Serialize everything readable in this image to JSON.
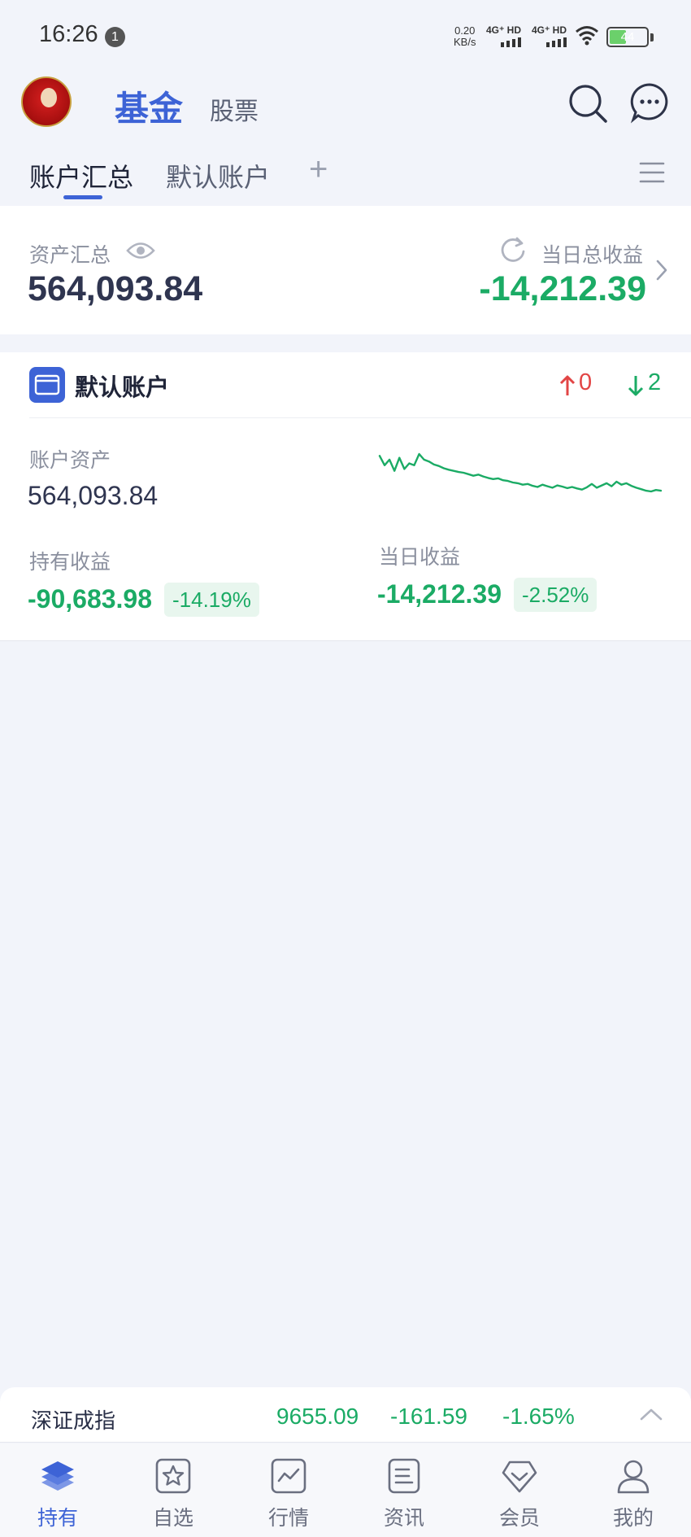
{
  "status_bar": {
    "time": "16:26",
    "notification_count": "1",
    "net_speed_value": "0.20",
    "net_speed_unit": "KB/s",
    "sim1": "4G⁺ HD",
    "sim2": "4G⁺ HD",
    "battery": "44"
  },
  "header": {
    "tab_fund": "基金",
    "tab_stock": "股票"
  },
  "subtabs": {
    "active": "账户汇总",
    "default_account": "默认账户",
    "add": "+"
  },
  "summary": {
    "total_assets_label": "资产汇总",
    "total_assets": "564,093.84",
    "daily_profit_label": "当日总收益",
    "daily_profit": "-14,212.39"
  },
  "account": {
    "name": "默认账户",
    "up_count": "0",
    "down_count": "2",
    "assets_label": "账户资产",
    "assets": "564,093.84",
    "holding_profit_label": "持有收益",
    "holding_profit": "-90,683.98",
    "holding_profit_pct": "-14.19%",
    "daily_profit_label": "当日收益",
    "daily_profit": "-14,212.39",
    "daily_profit_pct": "-2.52%",
    "trend": [
      0.95,
      0.7,
      0.85,
      0.55,
      0.9,
      0.6,
      0.75,
      0.7,
      1.0,
      0.85,
      0.8,
      0.72,
      0.68,
      0.62,
      0.58,
      0.55,
      0.52,
      0.5,
      0.46,
      0.42,
      0.45,
      0.4,
      0.36,
      0.33,
      0.35,
      0.3,
      0.28,
      0.24,
      0.22,
      0.18,
      0.2,
      0.15,
      0.12,
      0.18,
      0.14,
      0.1,
      0.16,
      0.13,
      0.09,
      0.12,
      0.08,
      0.05,
      0.11,
      0.2,
      0.1,
      0.16,
      0.22,
      0.14,
      0.26,
      0.18,
      0.22,
      0.15,
      0.1,
      0.06,
      0.02,
      0.0,
      0.04,
      0.02
    ]
  },
  "index_bar": {
    "name": "深证成指",
    "value": "9655.09",
    "change": "-161.59",
    "change_pct": "-1.65%"
  },
  "bottom_nav": [
    {
      "label": "持有",
      "icon": "holdings-layers-icon",
      "active": true
    },
    {
      "label": "自选",
      "icon": "watchlist-star-icon",
      "active": false
    },
    {
      "label": "行情",
      "icon": "market-chart-icon",
      "active": false
    },
    {
      "label": "资讯",
      "icon": "news-document-icon",
      "active": false
    },
    {
      "label": "会员",
      "icon": "member-diamond-icon",
      "active": false
    },
    {
      "label": "我的",
      "icon": "profile-person-icon",
      "active": false
    }
  ],
  "colors": {
    "accent": "#3d63d6",
    "loss_green": "#1bab65",
    "gain_red": "#e24545",
    "background": "#f2f4fa"
  }
}
